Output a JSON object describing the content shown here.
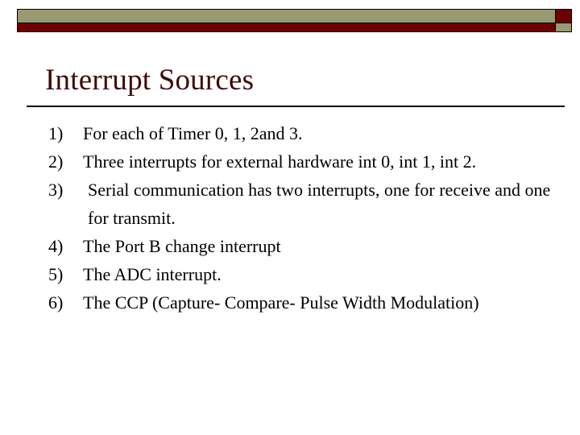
{
  "slide": {
    "title": "Interrupt Sources",
    "colors": {
      "title_text": "#3f0a0a",
      "body_text": "#000000",
      "bar_tan": "#9a9a72",
      "bar_red": "#6b0000",
      "rule": "#000000",
      "background": "#ffffff"
    },
    "decor": {
      "bar_name": "header-decorative-bar",
      "checker_name": "header-checker-accent"
    },
    "list": [
      {
        "marker": "1)",
        "text": "For each of Timer 0, 1, 2and 3.",
        "extra_indent": false
      },
      {
        "marker": "2)",
        "text": "Three interrupts for external hardware int 0, int 1, int 2.",
        "extra_indent": false
      },
      {
        "marker": "3)",
        "text": "Serial communication has two interrupts, one for receive and one for transmit.",
        "extra_indent": true
      },
      {
        "marker": "4)",
        "text": "The Port B change interrupt",
        "extra_indent": false
      },
      {
        "marker": "5)",
        "text": "The ADC interrupt.",
        "extra_indent": false
      },
      {
        "marker": "6)",
        "text": "The CCP (Capture- Compare- Pulse Width Modulation)",
        "extra_indent": false
      }
    ]
  }
}
